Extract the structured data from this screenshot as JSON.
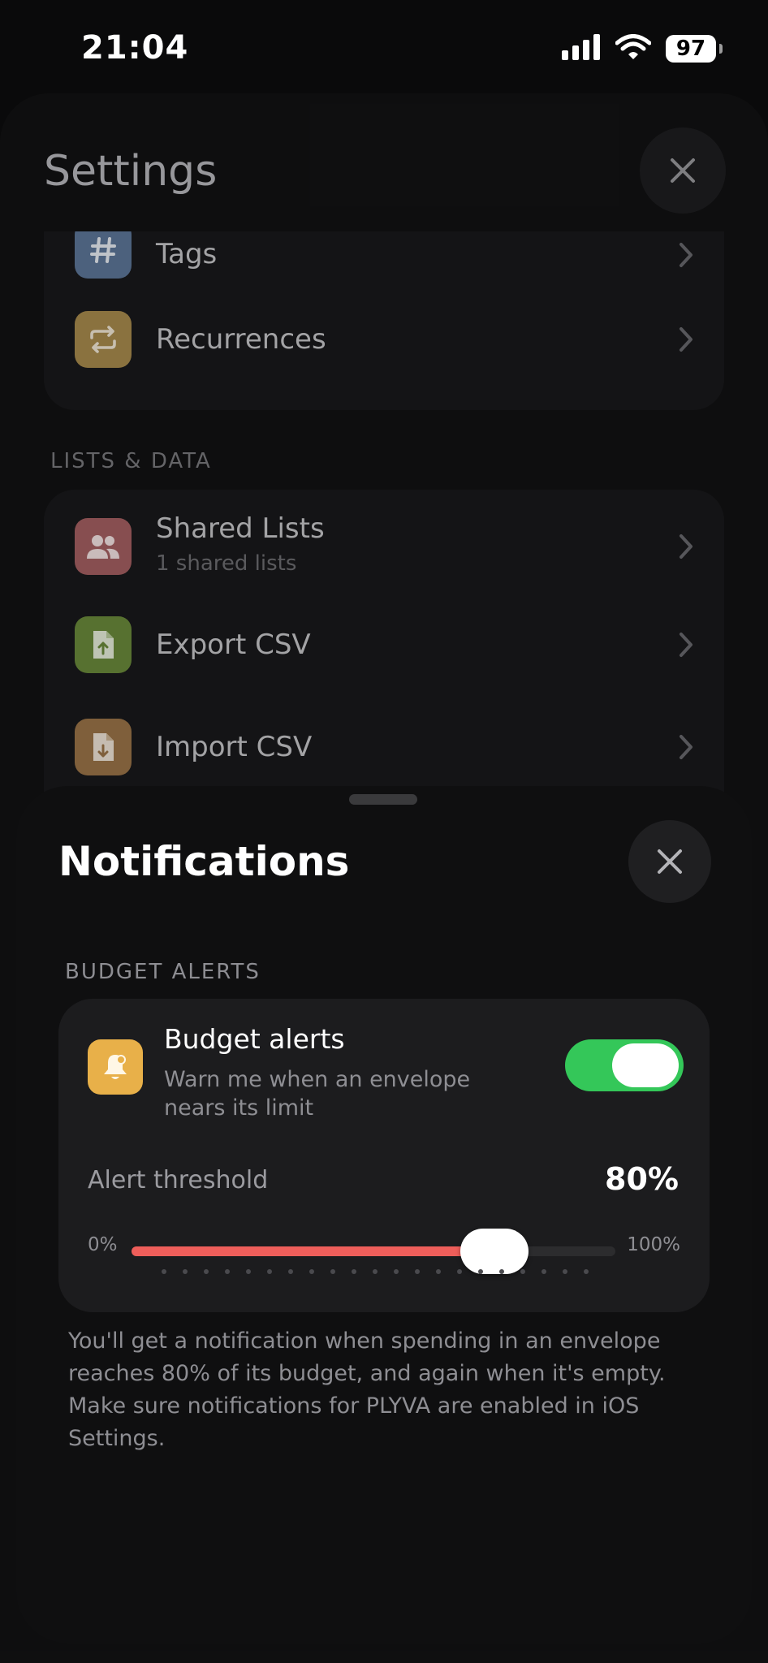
{
  "status_bar": {
    "time": "21:04",
    "battery": "97"
  },
  "settings": {
    "title": "Settings",
    "group_top": [
      {
        "label": "Tags",
        "icon": "hash-icon",
        "color": "#5d7799"
      },
      {
        "label": "Recurrences",
        "icon": "repeat-icon",
        "color": "#a98b4e"
      }
    ],
    "lists_section_label": "LISTS & DATA",
    "group_lists": [
      {
        "label": "Shared Lists",
        "sub": "1 shared lists",
        "icon": "people-icon",
        "color": "#a56062"
      },
      {
        "label": "Export CSV",
        "icon": "file-export-icon",
        "color": "#6b8a3b"
      },
      {
        "label": "Import CSV",
        "icon": "file-import-icon",
        "color": "#9b7548"
      }
    ]
  },
  "notifications": {
    "title": "Notifications",
    "section_label": "BUDGET ALERTS",
    "budget_alerts": {
      "title": "Budget alerts",
      "subtitle": "Warn me when an envelope nears its limit",
      "enabled": true,
      "icon": "bell-icon"
    },
    "threshold": {
      "label": "Alert threshold",
      "value_text": "80%",
      "min_label": "0%",
      "max_label": "100%",
      "value_percent": 75,
      "tick_count": 21
    },
    "footer": "You'll get a notification when spending in an envelope reaches 80% of its budget, and again when it's empty. Make sure notifications for PLYVA are enabled in iOS Settings."
  }
}
